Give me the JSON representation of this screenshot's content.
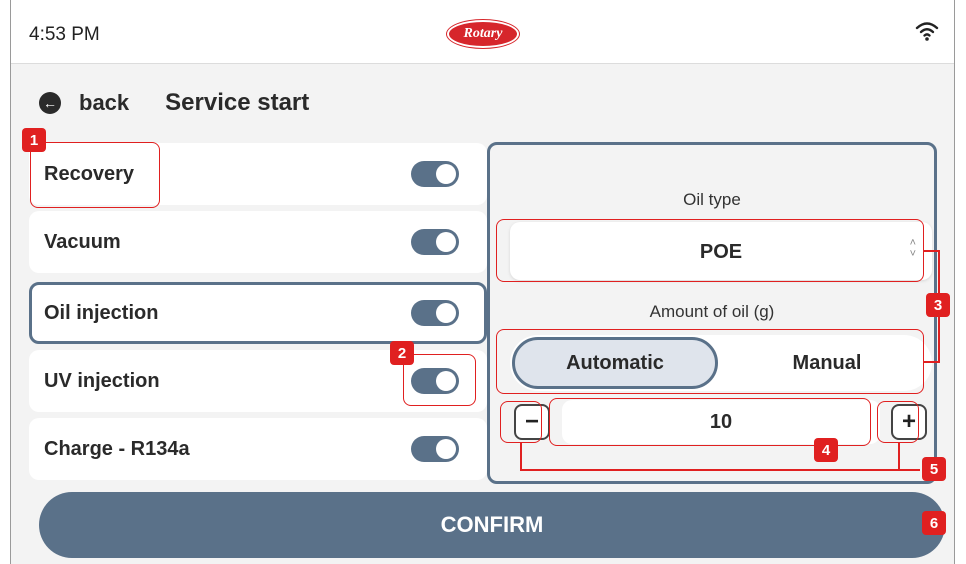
{
  "status_bar": {
    "time": "4:53 PM",
    "brand": "Rotary",
    "wifi_icon": "wifi-icon"
  },
  "header": {
    "back_label": "back",
    "back_icon": "arrow-left-circle-icon",
    "title": "Service start"
  },
  "services": [
    {
      "label": "Recovery",
      "enabled": true
    },
    {
      "label": "Vacuum",
      "enabled": true
    },
    {
      "label": "Oil injection",
      "enabled": true,
      "selected": true
    },
    {
      "label": "UV injection",
      "enabled": true
    },
    {
      "label": "Charge - R134a",
      "enabled": true
    }
  ],
  "oil_panel": {
    "oil_type_label": "Oil type",
    "oil_type_value": "POE",
    "amount_label": "Amount of oil (g)",
    "mode_options": [
      "Automatic",
      "Manual"
    ],
    "mode_selected": "Automatic",
    "amount_value": "10",
    "decrement_symbol": "−",
    "increment_symbol": "+"
  },
  "confirm_label": "CONFIRM",
  "annotations": [
    "1",
    "2",
    "3",
    "4",
    "5",
    "6"
  ],
  "colors": {
    "accent": "#5a7189",
    "callout": "#e02020",
    "background": "#f3f3f3",
    "card": "#ffffff",
    "selected_segment": "#dfe4ec"
  }
}
